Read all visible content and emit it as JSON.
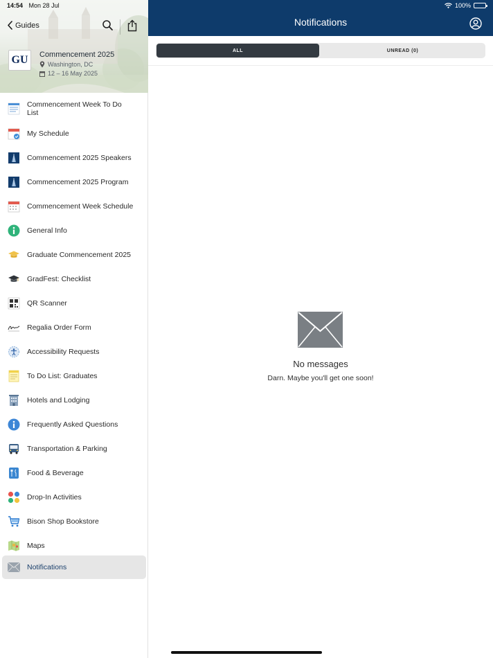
{
  "status": {
    "time": "14:54",
    "date": "Mon 28 Jul",
    "battery": "100%"
  },
  "sidebar": {
    "back_label": "Guides",
    "event": {
      "logo_text": "GU",
      "title": "Commencement 2025",
      "location": "Washington, DC",
      "dates": "12 – 16 May 2025"
    },
    "items": [
      {
        "label": "Commencement Week To Do List",
        "icon": "checklist-icon"
      },
      {
        "label": "My Schedule",
        "icon": "calendar-check-icon"
      },
      {
        "label": "Commencement 2025 Speakers",
        "icon": "speakers-book-icon"
      },
      {
        "label": "Commencement 2025 Program",
        "icon": "program-book-icon"
      },
      {
        "label": "Commencement Week Schedule",
        "icon": "calendar-icon"
      },
      {
        "label": "General Info",
        "icon": "info-green-icon"
      },
      {
        "label": "Graduate Commencement 2025",
        "icon": "graduation-cap-gold-icon"
      },
      {
        "label": "GradFest: Checklist",
        "icon": "graduation-cap-icon"
      },
      {
        "label": "QR Scanner",
        "icon": "qr-code-icon"
      },
      {
        "label": "Regalia Order Form",
        "icon": "signature-icon"
      },
      {
        "label": "Accessibility Requests",
        "icon": "accessibility-icon"
      },
      {
        "label": "To Do List: Graduates",
        "icon": "notepad-icon"
      },
      {
        "label": "Hotels and Lodging",
        "icon": "hotel-icon"
      },
      {
        "label": "Frequently Asked Questions",
        "icon": "info-blue-icon"
      },
      {
        "label": "Transportation & Parking",
        "icon": "bus-icon"
      },
      {
        "label": "Food & Beverage",
        "icon": "food-icon"
      },
      {
        "label": "Drop-In Activities",
        "icon": "activities-dots-icon"
      },
      {
        "label": "Bison Shop Bookstore",
        "icon": "shopping-cart-icon"
      },
      {
        "label": "Maps",
        "icon": "map-icon"
      },
      {
        "label": "Notifications",
        "icon": "envelope-icon",
        "selected": true
      }
    ]
  },
  "main": {
    "title": "Notifications",
    "tabs": [
      {
        "label": "ALL",
        "active": true
      },
      {
        "label": "UNREAD (0)",
        "active": false
      }
    ],
    "empty": {
      "title": "No messages",
      "subtitle": "Darn. Maybe you'll get one soon!"
    }
  },
  "colors": {
    "nav_bar": "#0e3b6b",
    "active_tab": "#333a41",
    "selected_row": "#e6e6e6",
    "envelope": "#7a7f84"
  }
}
